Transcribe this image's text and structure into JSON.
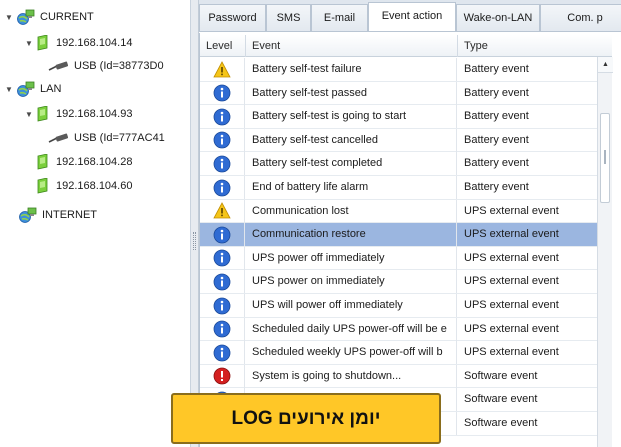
{
  "tree": {
    "items": [
      {
        "label": "CURRENT",
        "kind": "network",
        "expanded": true,
        "icon": "network-globe-icon"
      },
      {
        "label": "192.168.104.14",
        "kind": "computer",
        "expanded": true,
        "icon": "computer-icon"
      },
      {
        "label": "USB (Id=38773D0",
        "kind": "usb",
        "icon": "usb-cable-icon"
      },
      {
        "label": "LAN",
        "kind": "network",
        "expanded": true,
        "icon": "network-globe-icon"
      },
      {
        "label": "192.168.104.93",
        "kind": "computer",
        "expanded": true,
        "icon": "computer-icon"
      },
      {
        "label": "USB (Id=777AC41",
        "kind": "usb",
        "icon": "usb-cable-icon"
      },
      {
        "label": "192.168.104.28",
        "kind": "computer",
        "icon": "computer-icon"
      },
      {
        "label": "192.168.104.60",
        "kind": "computer",
        "icon": "computer-icon"
      },
      {
        "label": "INTERNET",
        "kind": "network",
        "icon": "network-globe-icon"
      }
    ]
  },
  "tabs": [
    {
      "label": "Password"
    },
    {
      "label": "SMS"
    },
    {
      "label": "E-mail"
    },
    {
      "label": "Event action",
      "active": true
    },
    {
      "label": "Wake-on-LAN"
    },
    {
      "label": "Com. p"
    }
  ],
  "table": {
    "headers": {
      "level": "Level",
      "event": "Event",
      "type": "Type"
    },
    "rows": [
      {
        "level": "warning",
        "event": "Battery self-test failure",
        "type": "Battery event"
      },
      {
        "level": "info",
        "event": "Battery self-test passed",
        "type": "Battery event"
      },
      {
        "level": "info",
        "event": "Battery self-test is going to start",
        "type": "Battery event"
      },
      {
        "level": "info",
        "event": "Battery self-test cancelled",
        "type": "Battery event"
      },
      {
        "level": "info",
        "event": "Battery self-test completed",
        "type": "Battery event"
      },
      {
        "level": "info",
        "event": "End of battery life alarm",
        "type": "Battery event"
      },
      {
        "level": "warning",
        "event": "Communication lost",
        "type": "UPS external event"
      },
      {
        "level": "info",
        "event": "Communication restore",
        "type": "UPS external event",
        "selected": true
      },
      {
        "level": "info",
        "event": "UPS power off immediately",
        "type": "UPS external event"
      },
      {
        "level": "info",
        "event": "UPS power on immediately",
        "type": "UPS external event"
      },
      {
        "level": "info",
        "event": "UPS will power off immediately",
        "type": "UPS external event"
      },
      {
        "level": "info",
        "event": "Scheduled daily UPS power-off will be e",
        "type": "UPS external event"
      },
      {
        "level": "info",
        "event": "Scheduled weekly UPS power-off will b",
        "type": "UPS external event"
      },
      {
        "level": "error",
        "event": "System is going to shutdown...",
        "type": "Software event"
      },
      {
        "level": "info",
        "event": "",
        "type": "Software event"
      },
      {
        "level": "info",
        "event": "",
        "type": "Software event"
      }
    ]
  },
  "caption": {
    "text": "LOG יומן אירועים"
  },
  "colors": {
    "selection": "#9bb6e0",
    "caption_bg": "#ffc727",
    "info_blue": "#2f6bd3",
    "warning_yellow": "#f5c518",
    "error_red": "#d42020"
  }
}
